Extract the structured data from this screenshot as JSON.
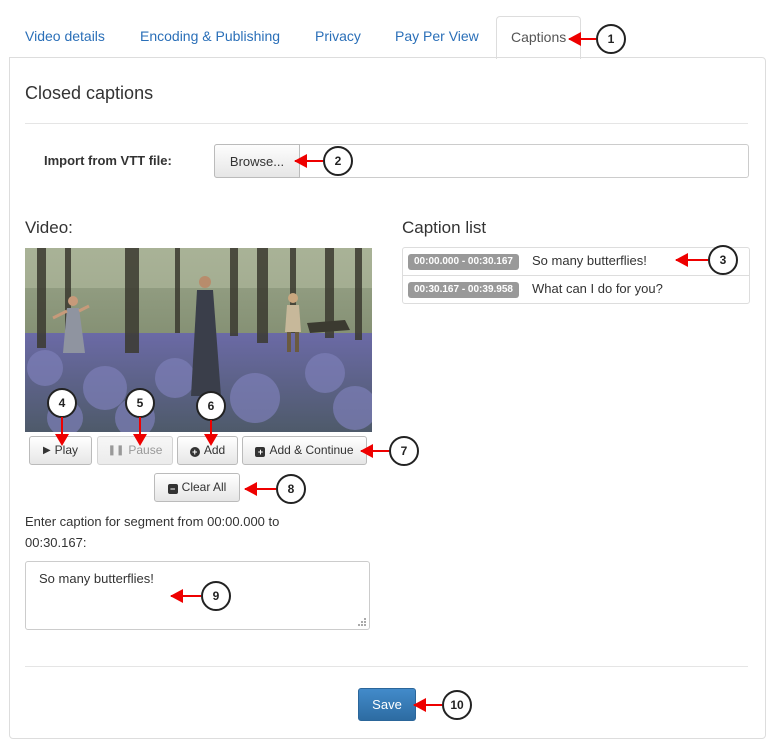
{
  "tabs": [
    {
      "label": "Video details"
    },
    {
      "label": "Encoding & Publishing"
    },
    {
      "label": "Privacy"
    },
    {
      "label": "Pay Per View"
    },
    {
      "label": "Captions"
    }
  ],
  "panel": {
    "title": "Closed captions",
    "import_label": "Import from VTT file:",
    "browse_label": "Browse...",
    "video_label": "Video:",
    "caption_list_label": "Caption list"
  },
  "captions": [
    {
      "time": "00:00.000 - 00:30.167",
      "text": "So many butterflies!"
    },
    {
      "time": "00:30.167 - 00:39.958",
      "text": "What can I do for you?"
    }
  ],
  "controls": {
    "play": "Play",
    "pause": "Pause",
    "add": "Add",
    "add_continue": "Add & Continue",
    "clear_all": "Clear All"
  },
  "segment_prompt": "Enter caption for segment from 00:00.000 to 00:30.167:",
  "caption_input_value": "So many butterflies!",
  "save_label": "Save",
  "callouts": [
    "1",
    "2",
    "3",
    "4",
    "5",
    "6",
    "7",
    "8",
    "9",
    "10"
  ],
  "colors": {
    "link": "#2a6fb8",
    "primary": "#3071a9",
    "arrow": "#ee0000",
    "badge": "#999999"
  }
}
